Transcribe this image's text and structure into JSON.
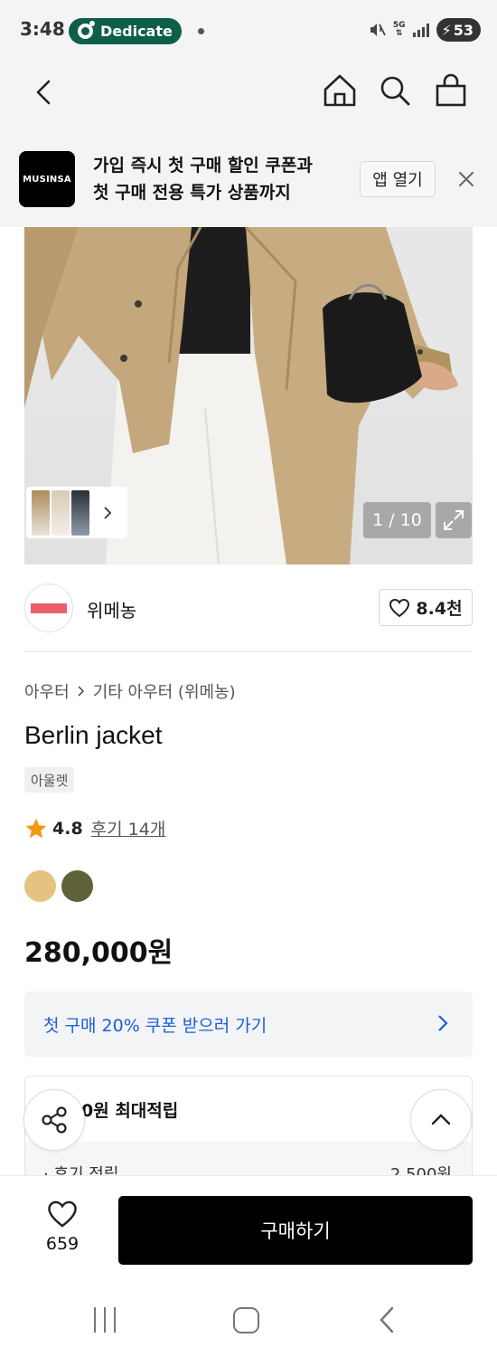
{
  "status_bar": {
    "time": "3:48",
    "notification_label": "Dedicate",
    "network_label": "5G",
    "battery_level": "53"
  },
  "promo_banner": {
    "logo_text": "MUSINSA",
    "line1": "가입 즉시 첫 구매 할인 쿠폰과",
    "line2": "첫 구매 전용 특가 상품까지",
    "open_app_label": "앱 열기"
  },
  "gallery": {
    "counter": "1 / 10"
  },
  "brand": {
    "name": "위메농",
    "likes": "8.4천"
  },
  "product": {
    "breadcrumb": [
      "아우터",
      "기타 아우터 (위메농)"
    ],
    "title": "Berlin jacket",
    "badge": "아울렛",
    "rating": "4.8",
    "reviews_label": "후기 14개",
    "colors": [
      "#e6c280",
      "#5f6138"
    ],
    "price": "280,000원"
  },
  "coupon": {
    "label": "첫 구매 20% 쿠폰 받으러 가기"
  },
  "points": {
    "title_visible": "0원 최대적립",
    "row_label": "· 후기 적립",
    "row_value": "2,500원"
  },
  "bottom_bar": {
    "like_count": "659",
    "buy_label": "구매하기"
  },
  "accent_colors": {
    "coupon_blue": "#1c5fd6",
    "star": "#f29a12",
    "notification_pill": "#0e5e4c"
  }
}
